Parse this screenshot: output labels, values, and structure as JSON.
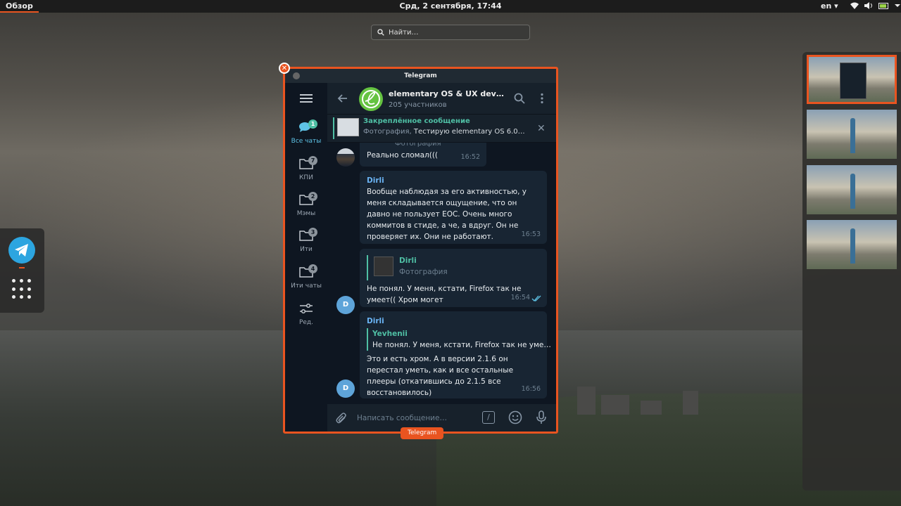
{
  "topbar": {
    "activities_label": "Обзор",
    "clock": "Срд, 2 сентября, 17:44",
    "language": "en ▾",
    "accent_color": "#e95420"
  },
  "search": {
    "placeholder": "Найти…"
  },
  "dash": {
    "apps": [
      "telegram-icon",
      "show-apps-icon"
    ]
  },
  "window": {
    "title": "Telegram",
    "label": "Telegram",
    "close_glyph": "✕"
  },
  "folders": [
    {
      "label": "Все чаты",
      "badge": "1"
    },
    {
      "label": "КПИ",
      "badge": "7"
    },
    {
      "label": "Мэмы",
      "badge": "2"
    },
    {
      "label": "Ити",
      "badge": "3"
    },
    {
      "label": "Ити чаты",
      "badge": "4"
    },
    {
      "label": "Ред."
    }
  ],
  "chat": {
    "title": "elementary OS & UX dev…",
    "subtitle": "205 участников"
  },
  "pinned": {
    "title": "Закреплённое сообщение",
    "kind": "Фотография,",
    "text": "Тестирую elementary OS 6.0…"
  },
  "messages": {
    "m1": {
      "reply_kind": "Фотография",
      "text": "Реально сломал(((",
      "time": "16:52"
    },
    "m2": {
      "sender": "Dirli",
      "text": "Вообще наблюдая за его активностью, у меня складывается ощущение, что он давно не пользует ЕОС. Очень много коммитов в стиде, а че, а вдруг. Он не проверяет их. Они не работают.",
      "time": "16:53",
      "avatar": "D"
    },
    "m3": {
      "reply_name": "Dirli",
      "reply_kind": "Фотография",
      "text": "Не понял. У меня, кстати, Firefox так не умеет(( Хром могет",
      "time": "16:54"
    },
    "m4": {
      "sender": "Dirli",
      "reply_name": "Yevhenii",
      "reply_text": "Не понял. У меня, кстати, Firefox так не уме…",
      "text": "Это и есть хром. А в версии 2.1.6 он перестал уметь, как и все остальные плееры (откатившись до 2.1.5 все восстановилось)",
      "time": "16:56",
      "avatar": "D"
    }
  },
  "composer": {
    "placeholder": "Написать сообщение…",
    "cmd_glyph": "/"
  }
}
